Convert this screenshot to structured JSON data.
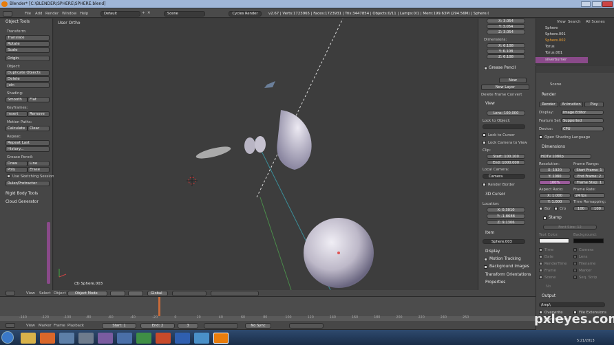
{
  "title_bar": {
    "title": "Blender* [C:\\BLENDER\\SPHERE\\SPHERE.blend]"
  },
  "menu": {
    "items": [
      "File",
      "Add",
      "Render",
      "Window",
      "Help"
    ],
    "layout": "Default",
    "scene": "Scene",
    "engine": "Cycles Render",
    "stats": "v2.67 | Verts:1723965 | Faces:1723931 | Tris:3447854 | Objects:0/11 | Lamps:0/1 | Mem:199.63M (294.56M) | Sphere.003"
  },
  "toolshelf": {
    "header": "Object Tools",
    "transform_label": "Transform:",
    "translate": "Translate",
    "rotate": "Rotate",
    "scale": "Scale",
    "origin": "Origin",
    "object_label": "Object:",
    "duplicate": "Duplicate Objects",
    "delete": "Delete",
    "join": "Join",
    "shading_label": "Shading:",
    "smooth": "Smooth",
    "flat": "Flat",
    "keyframes_label": "Keyframes:",
    "insert": "Insert",
    "remove": "Remove",
    "motion_label": "Motion Paths:",
    "calculate": "Calculate",
    "clear": "Clear",
    "repeat_label": "Repeat:",
    "repeat_last": "Repeat Last",
    "history": "History...",
    "grease_label": "Grease Pencil:",
    "draw": "Draw",
    "line": "Line",
    "poly": "Poly",
    "erase": "Erase",
    "sketching": "Use Sketching Session",
    "ruler": "Ruler/Protractor",
    "rigid": "Rigid Body Tools",
    "cloud": "Cloud Generator"
  },
  "viewport": {
    "view_label": "User Ortho",
    "object_label": "(3) Sphere.003"
  },
  "properties_panel": {
    "dim_label": "Dimensions:",
    "loc_top": [
      "X: 3.054",
      "Y: 3.054",
      "Z: 3.054"
    ],
    "dims": [
      "X: 6.108",
      "Y: 6.108",
      "Z: 6.108"
    ],
    "grease_pencil": "Grease Pencil",
    "new": "New",
    "new_layer": "New Layer",
    "delete_frame": "Delete Frame",
    "convert": "Convert",
    "view": "View",
    "lens": "Lens: 100.000",
    "lock_to_object": "Lock to Object:",
    "lock_to_cursor": "Lock to Cursor",
    "lock_camera": "Lock Camera to View",
    "clip": "Clip:",
    "clip_start": "Start: 100.100",
    "clip_end": "End: 1000.000",
    "local_camera": "Local Camera:",
    "camera": "Camera",
    "render_border": "Render Border",
    "cursor": "3D Cursor",
    "location": "Location:",
    "cursor_loc": [
      "X: 0.3010",
      "Y: -1.8688",
      "Z: 9.1306"
    ],
    "item": "Item",
    "item_name": "Sphere.003",
    "display": "Display",
    "motion_tracking": "Motion Tracking",
    "background_images": "Background Images",
    "transform_orientations": "Transform Orientations",
    "properties": "Properties"
  },
  "outliner": {
    "view": "View",
    "search": "Search",
    "all_scenes": "All Scenes",
    "items": [
      "Sphere",
      "Sphere.001",
      "Sphere.002",
      "Torus",
      "Torus.001",
      "silverburner"
    ]
  },
  "render_props": {
    "scene": "Scene",
    "render": "Render",
    "render_btn": "Render",
    "animation_btn": "Animation",
    "play_btn": "Play",
    "display_label": "Display:",
    "display_val": "Image Editor",
    "feature_label": "Feature Set:",
    "feature_val": "Supported",
    "device_label": "Device:",
    "device_val": "CPU",
    "osl": "Open Shading Language",
    "dimensions": "Dimensions",
    "preset": "HDTV 1080p",
    "resolution": "Resolution:",
    "res_x": "X: 1920",
    "res_y": "Y: 1080",
    "res_pct": "100%",
    "frame_range": "Frame Range:",
    "start_frame": "Start Frame: 1",
    "end_frame": "End Frame: 2",
    "frame_step": "Frame Step: 1",
    "aspect": "Aspect Ratio:",
    "asp_x": "X: 1.000",
    "asp_y": "Y: 1.000",
    "frame_rate": "Frame Rate:",
    "fps": "24 fps",
    "time_remap": "Time Remapping:",
    "remap_old": "100",
    "remap_new": "100",
    "border": "Bor",
    "crop": "Cro",
    "stamp": "Stamp",
    "font_size": "Font Size: 12",
    "text_color": "Text Color:",
    "background": "Background:",
    "stamp_items_l": [
      "Time",
      "Date",
      "RenderTime",
      "Frame",
      "Scene"
    ],
    "stamp_items_r": [
      "Camera",
      "Lens",
      "Filename",
      "Marker",
      "Seq. Strip"
    ],
    "note": "No",
    "output": "Output",
    "output_path": "/tmp\\",
    "overwrite": "Overwrite",
    "file_ext": "File Extensions",
    "placeholders": "Placeholders"
  },
  "viewport_header": {
    "view": "View",
    "select": "Select",
    "object": "Object",
    "mode": "Object Mode",
    "orientation": "Global"
  },
  "timeline": {
    "ticks": [
      "-140",
      "-120",
      "-100",
      "-80",
      "-60",
      "-40",
      "-20",
      "0",
      "20",
      "40",
      "60",
      "80",
      "100",
      "120",
      "140",
      "160",
      "180",
      "200",
      "220",
      "240",
      "260"
    ],
    "view": "View",
    "marker": "Marker",
    "frame": "Frame",
    "playback": "Playback",
    "start": "Start: 1",
    "end": "End: 2",
    "current": "3",
    "sync": "No Sync"
  },
  "taskbar": {
    "time": "5:21/2013"
  },
  "watermark": "pxleyes.com"
}
